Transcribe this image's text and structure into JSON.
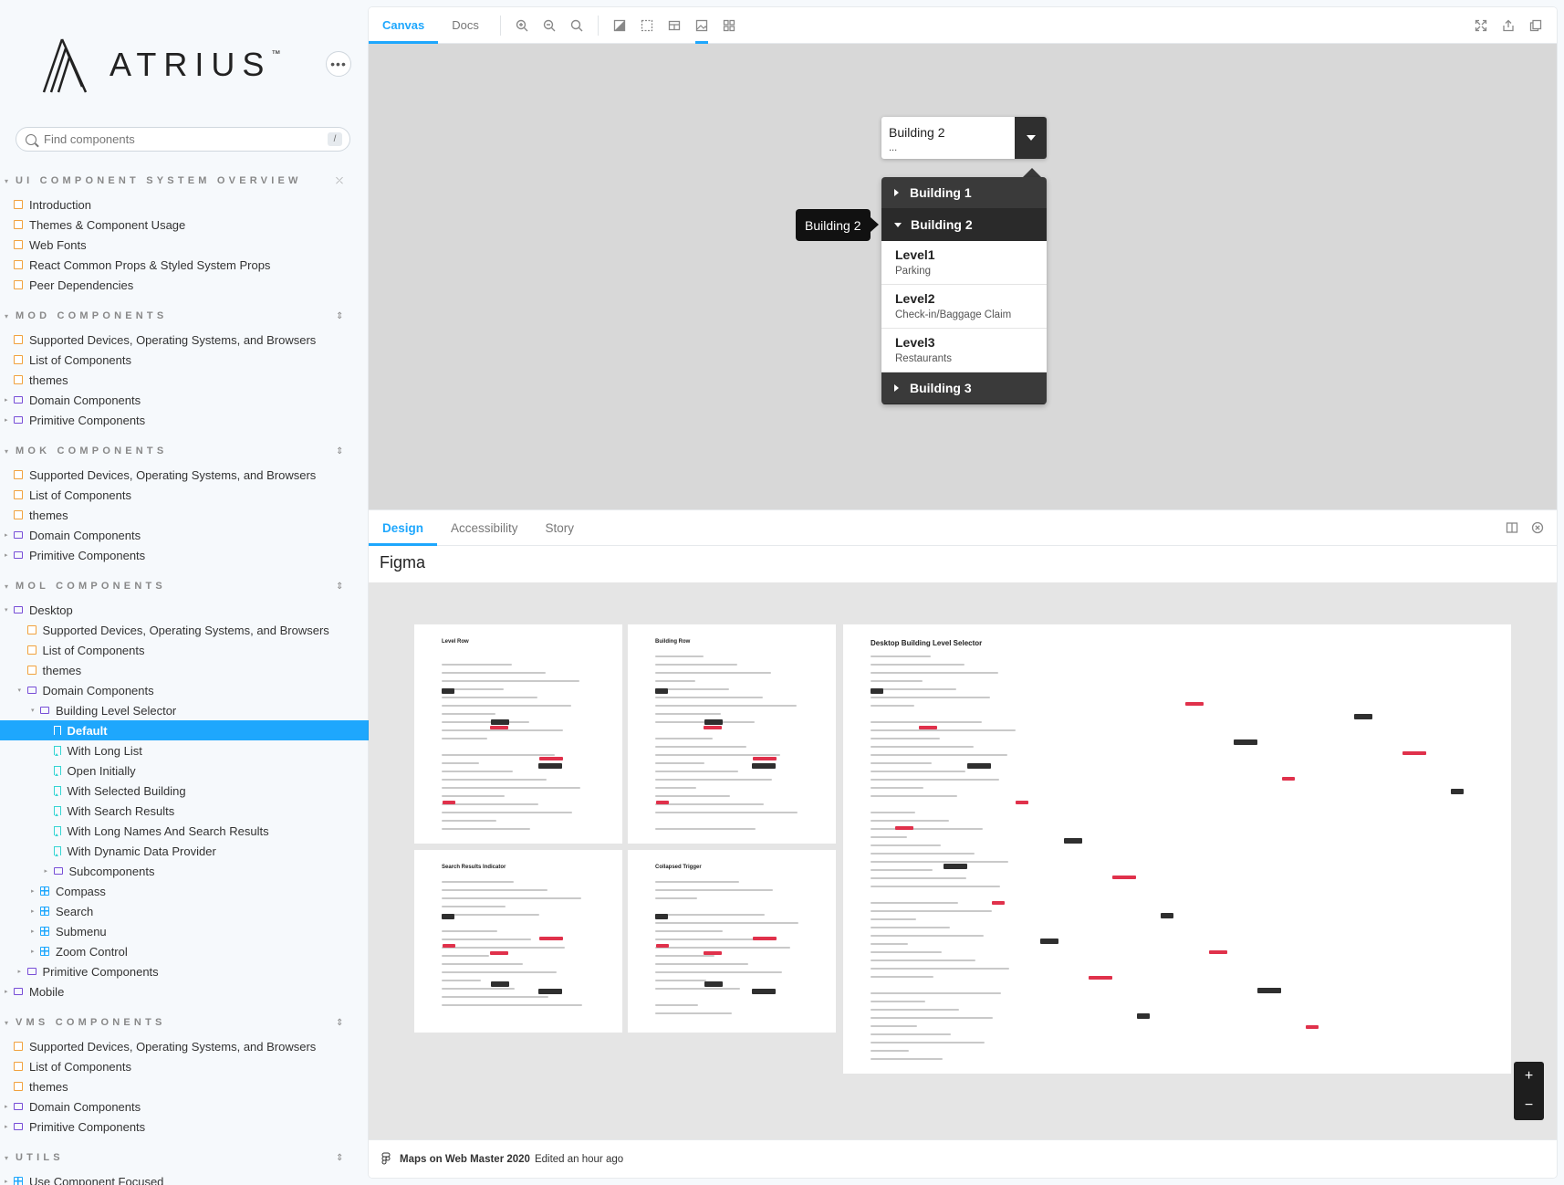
{
  "brand": {
    "name": "ATRIUS",
    "trademark": "™"
  },
  "search": {
    "placeholder": "Find components",
    "shortcut": "/"
  },
  "sections": [
    {
      "label": "UI COMPONENT SYSTEM OVERVIEW",
      "items": [
        {
          "label": "Introduction",
          "type": "doc"
        },
        {
          "label": "Themes & Component Usage",
          "type": "doc"
        },
        {
          "label": "Web Fonts",
          "type": "doc"
        },
        {
          "label": "React Common Props & Styled System Props",
          "type": "doc"
        },
        {
          "label": "Peer Dependencies",
          "type": "doc"
        }
      ]
    },
    {
      "label": "MOD COMPONENTS",
      "items": [
        {
          "label": "Supported Devices, Operating Systems, and Browsers",
          "type": "doc"
        },
        {
          "label": "List of Components",
          "type": "doc"
        },
        {
          "label": "themes",
          "type": "doc"
        },
        {
          "label": "Domain Components",
          "type": "folder"
        },
        {
          "label": "Primitive Components",
          "type": "folder"
        }
      ]
    },
    {
      "label": "MOK COMPONENTS",
      "items": [
        {
          "label": "Supported Devices, Operating Systems, and Browsers",
          "type": "doc"
        },
        {
          "label": "List of Components",
          "type": "doc"
        },
        {
          "label": "themes",
          "type": "doc"
        },
        {
          "label": "Domain Components",
          "type": "folder"
        },
        {
          "label": "Primitive Components",
          "type": "folder"
        }
      ]
    },
    {
      "label": "MOL COMPONENTS",
      "items": [
        {
          "label": "Desktop",
          "type": "folder",
          "indent": 0,
          "open": true
        },
        {
          "label": "Supported Devices, Operating Systems, and Browsers",
          "type": "doc",
          "indent": 1
        },
        {
          "label": "List of Components",
          "type": "doc",
          "indent": 1
        },
        {
          "label": "themes",
          "type": "doc",
          "indent": 1
        },
        {
          "label": "Domain Components",
          "type": "folder",
          "indent": 1,
          "open": true
        },
        {
          "label": "Building Level Selector",
          "type": "folder",
          "indent": 2,
          "open": true
        },
        {
          "label": "Default",
          "type": "story",
          "indent": 3,
          "selected": true
        },
        {
          "label": "With Long List",
          "type": "story",
          "indent": 3
        },
        {
          "label": "Open Initially",
          "type": "story",
          "indent": 3
        },
        {
          "label": "With Selected Building",
          "type": "story",
          "indent": 3
        },
        {
          "label": "With Search Results",
          "type": "story",
          "indent": 3
        },
        {
          "label": "With Long Names And Search Results",
          "type": "story",
          "indent": 3
        },
        {
          "label": "With Dynamic Data Provider",
          "type": "story",
          "indent": 3
        },
        {
          "label": "Subcomponents",
          "type": "folder",
          "indent": 3
        },
        {
          "label": "Compass",
          "type": "comp",
          "indent": 2
        },
        {
          "label": "Search",
          "type": "comp",
          "indent": 2
        },
        {
          "label": "Submenu",
          "type": "comp",
          "indent": 2
        },
        {
          "label": "Zoom Control",
          "type": "comp",
          "indent": 2
        },
        {
          "label": "Primitive Components",
          "type": "folder",
          "indent": 1
        },
        {
          "label": "Mobile",
          "type": "folder",
          "indent": 0
        }
      ]
    },
    {
      "label": "VMS COMPONENTS",
      "items": [
        {
          "label": "Supported Devices, Operating Systems, and Browsers",
          "type": "doc"
        },
        {
          "label": "List of Components",
          "type": "doc"
        },
        {
          "label": "themes",
          "type": "doc"
        },
        {
          "label": "Domain Components",
          "type": "folder"
        },
        {
          "label": "Primitive Components",
          "type": "folder"
        }
      ]
    },
    {
      "label": "UTILS",
      "items": [
        {
          "label": "Use Component Focused",
          "type": "comp"
        }
      ]
    }
  ],
  "toolbar": {
    "tabs": [
      {
        "label": "Canvas",
        "active": true
      },
      {
        "label": "Docs",
        "active": false
      }
    ],
    "tools": [
      "zoom-in-icon",
      "zoom-out-icon",
      "zoom-reset-icon",
      "background-icon",
      "grid-icon",
      "measure-icon",
      "image-icon",
      "outline-icon"
    ],
    "right_tools": [
      "fullscreen-icon",
      "share-icon",
      "copy-link-icon"
    ]
  },
  "selector": {
    "title": "Building 2",
    "subtitle": "...",
    "tooltip": "Building 2",
    "buildings": [
      {
        "name": "Building 1",
        "open": false
      },
      {
        "name": "Building 2",
        "open": true,
        "levels": [
          {
            "name": "Level1",
            "desc": "Parking"
          },
          {
            "name": "Level2",
            "desc": "Check-in/Baggage Claim"
          },
          {
            "name": "Level3",
            "desc": "Restaurants"
          }
        ]
      },
      {
        "name": "Building 3",
        "open": false
      }
    ]
  },
  "addons": {
    "tabs": [
      {
        "label": "Design",
        "active": true
      },
      {
        "label": "Accessibility",
        "active": false
      },
      {
        "label": "Story",
        "active": false
      }
    ],
    "heading": "Figma",
    "frames": [
      {
        "title": "Level Row"
      },
      {
        "title": "Building Row"
      },
      {
        "title": "Desktop Building Level Selector"
      },
      {
        "title": "Search Results Indicator"
      },
      {
        "title": "Collapsed Trigger"
      }
    ],
    "zoom": {
      "in": "+",
      "out": "−"
    },
    "footer": {
      "file": "Maps on Web Master 2020",
      "edited": "Edited an hour ago"
    }
  },
  "colors": {
    "accent": "#1ea7fd",
    "doc": "#f1a13d",
    "folder": "#774dd7",
    "story": "#37d5d3",
    "dark": "#2a2a2a"
  }
}
